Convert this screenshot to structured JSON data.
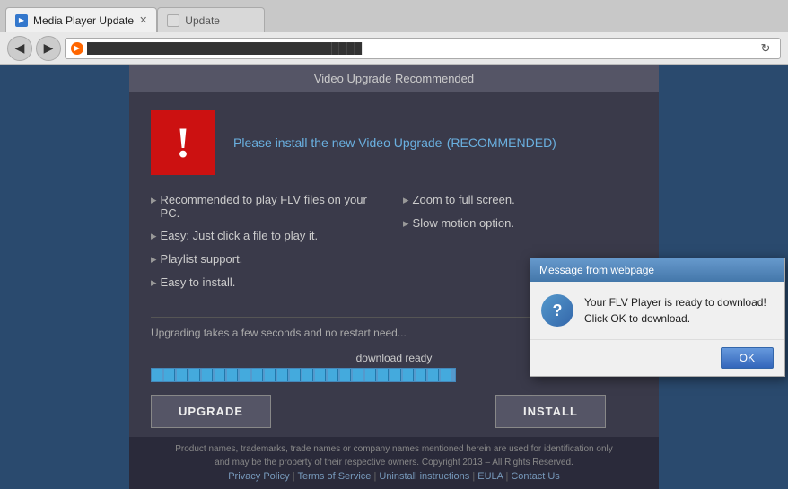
{
  "browser": {
    "back_label": "◀",
    "forward_label": "▶",
    "address_value": "████████████████████",
    "refresh_label": "↻",
    "tabs": [
      {
        "id": "tab1",
        "label": "Media Player Update",
        "active": true,
        "close": "✕"
      },
      {
        "id": "tab2",
        "label": "Update",
        "active": false,
        "close": ""
      }
    ]
  },
  "page": {
    "title": "Video Upgrade Recommended",
    "header": "Please install the new Video Upgrade",
    "recommended_badge": "(RECOMMENDED)",
    "features_left": [
      "Recommended to play FLV files on your PC.",
      "Easy: Just click a file to play it.",
      "Playlist support.",
      "Easy to install."
    ],
    "features_right": [
      "Zoom to full screen.",
      "Slow motion option."
    ],
    "upgrade_note": "Upgrading takes a few seconds and no restart need...",
    "progress_label": "download ready",
    "upgrade_btn": "UPGRADE",
    "install_btn": "INSTALL"
  },
  "footer": {
    "text1": "Product names, trademarks, trade names or company names mentioned herein are used for identification only",
    "text2": "and may be the property of their respective owners. Copyright 2013 – All Rights Reserved.",
    "links": [
      "Privacy Policy",
      "Terms of Service",
      "Uninstall instructions",
      "EULA",
      "Contact Us"
    ]
  },
  "modal": {
    "title": "Message from webpage",
    "question_icon": "?",
    "message_line1": "Your FLV Player is ready to download!",
    "message_line2": "Click OK to download.",
    "ok_label": "OK"
  }
}
